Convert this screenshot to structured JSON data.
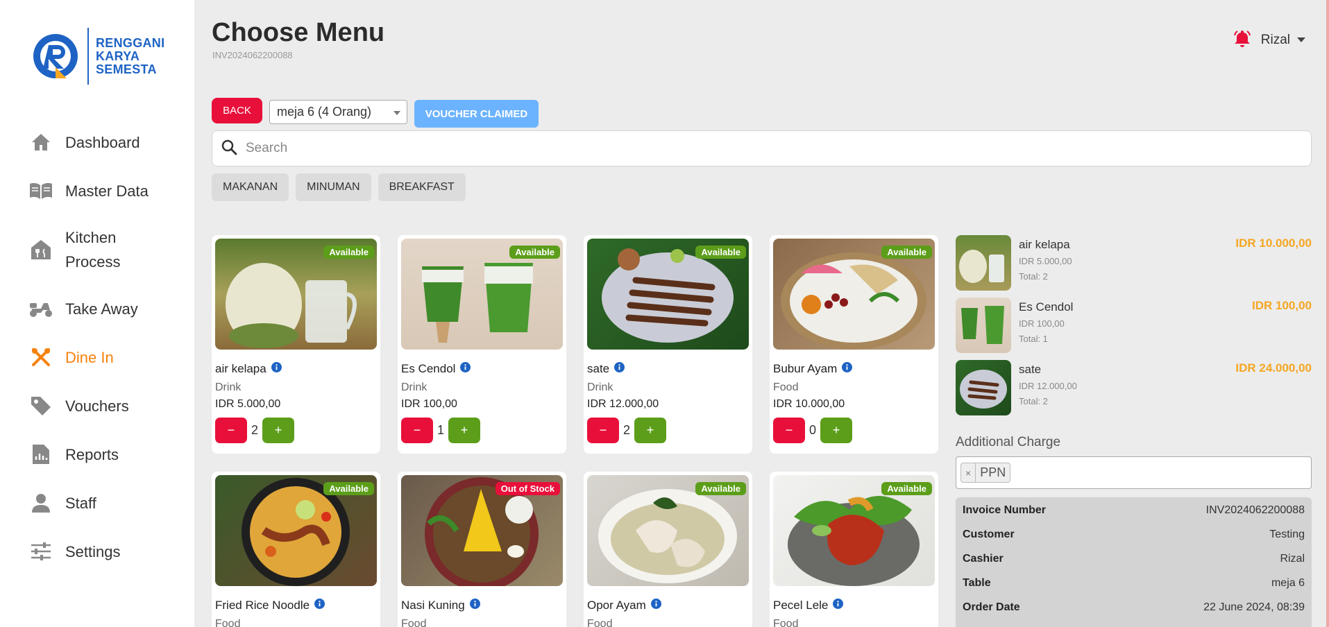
{
  "brand": {
    "line1": "RENGGANI",
    "line2": "KARYA",
    "line3": "SEMESTA"
  },
  "sidebar": {
    "items": [
      {
        "label": "Dashboard",
        "icon": "home-icon"
      },
      {
        "label": "Master Data",
        "icon": "book-icon"
      },
      {
        "label": "Kitchen Process",
        "icon": "kitchen-icon"
      },
      {
        "label": "Take Away",
        "icon": "scooter-icon"
      },
      {
        "label": "Dine In",
        "icon": "utensils-icon",
        "active": true
      },
      {
        "label": "Vouchers",
        "icon": "tag-icon"
      },
      {
        "label": "Reports",
        "icon": "report-icon"
      },
      {
        "label": "Staff",
        "icon": "person-icon"
      },
      {
        "label": "Settings",
        "icon": "sliders-icon"
      }
    ]
  },
  "header": {
    "title": "Choose Menu",
    "invoice": "INV2024062200088",
    "user": "Rizal"
  },
  "controls": {
    "back_label": "BACK",
    "table_select": "meja 6 (4 Orang)",
    "voucher_label": "VOUCHER CLAIMED",
    "search_placeholder": "Search",
    "categories": [
      "MAKANAN",
      "MINUMAN",
      "BREAKFAST"
    ]
  },
  "products": [
    {
      "name": "air kelapa",
      "type": "Drink",
      "price": "IDR 5.000,00",
      "qty": "2",
      "status": "Available"
    },
    {
      "name": "Es Cendol",
      "type": "Drink",
      "price": "IDR 100,00",
      "qty": "1",
      "status": "Available"
    },
    {
      "name": "sate",
      "type": "Drink",
      "price": "IDR 12.000,00",
      "qty": "2",
      "status": "Available"
    },
    {
      "name": "Bubur Ayam",
      "type": "Food",
      "price": "IDR 10.000,00",
      "qty": "0",
      "status": "Available"
    },
    {
      "name": "Fried Rice Noodle",
      "type": "Food",
      "status": "Available"
    },
    {
      "name": "Nasi Kuning",
      "type": "Food",
      "status": "Out of Stock"
    },
    {
      "name": "Opor Ayam",
      "type": "Food",
      "status": "Available"
    },
    {
      "name": "Pecel Lele",
      "type": "Food",
      "status": "Available"
    }
  ],
  "qty_buttons": {
    "minus": "−",
    "plus": "+"
  },
  "order": {
    "items": [
      {
        "name": "air kelapa",
        "unit": "IDR 5.000,00",
        "total": "Total: 2",
        "subtotal": "IDR 10.000,00"
      },
      {
        "name": "Es Cendol",
        "unit": "IDR 100,00",
        "total": "Total: 1",
        "subtotal": "IDR 100,00"
      },
      {
        "name": "sate",
        "unit": "IDR 12.000,00",
        "total": "Total: 2",
        "subtotal": "IDR 24.000,00"
      }
    ],
    "additional_charge_label": "Additional Charge",
    "charge_tag": "PPN",
    "charge_remove": "×"
  },
  "summary": {
    "rows": [
      {
        "key": "Invoice Number",
        "value": "INV2024062200088"
      },
      {
        "key": "Customer",
        "value": "Testing"
      },
      {
        "key": "Cashier",
        "value": "Rizal"
      },
      {
        "key": "Table",
        "value": "meja 6"
      },
      {
        "key": "Order Date",
        "value": "22 June 2024, 08:39"
      }
    ]
  },
  "colors": {
    "accent": "#f5820d",
    "danger": "#e8103a",
    "success": "#5c9e1a",
    "brand": "#1e63c4",
    "voucher": "#6cb3ff",
    "subtotal": "#f5a623"
  }
}
